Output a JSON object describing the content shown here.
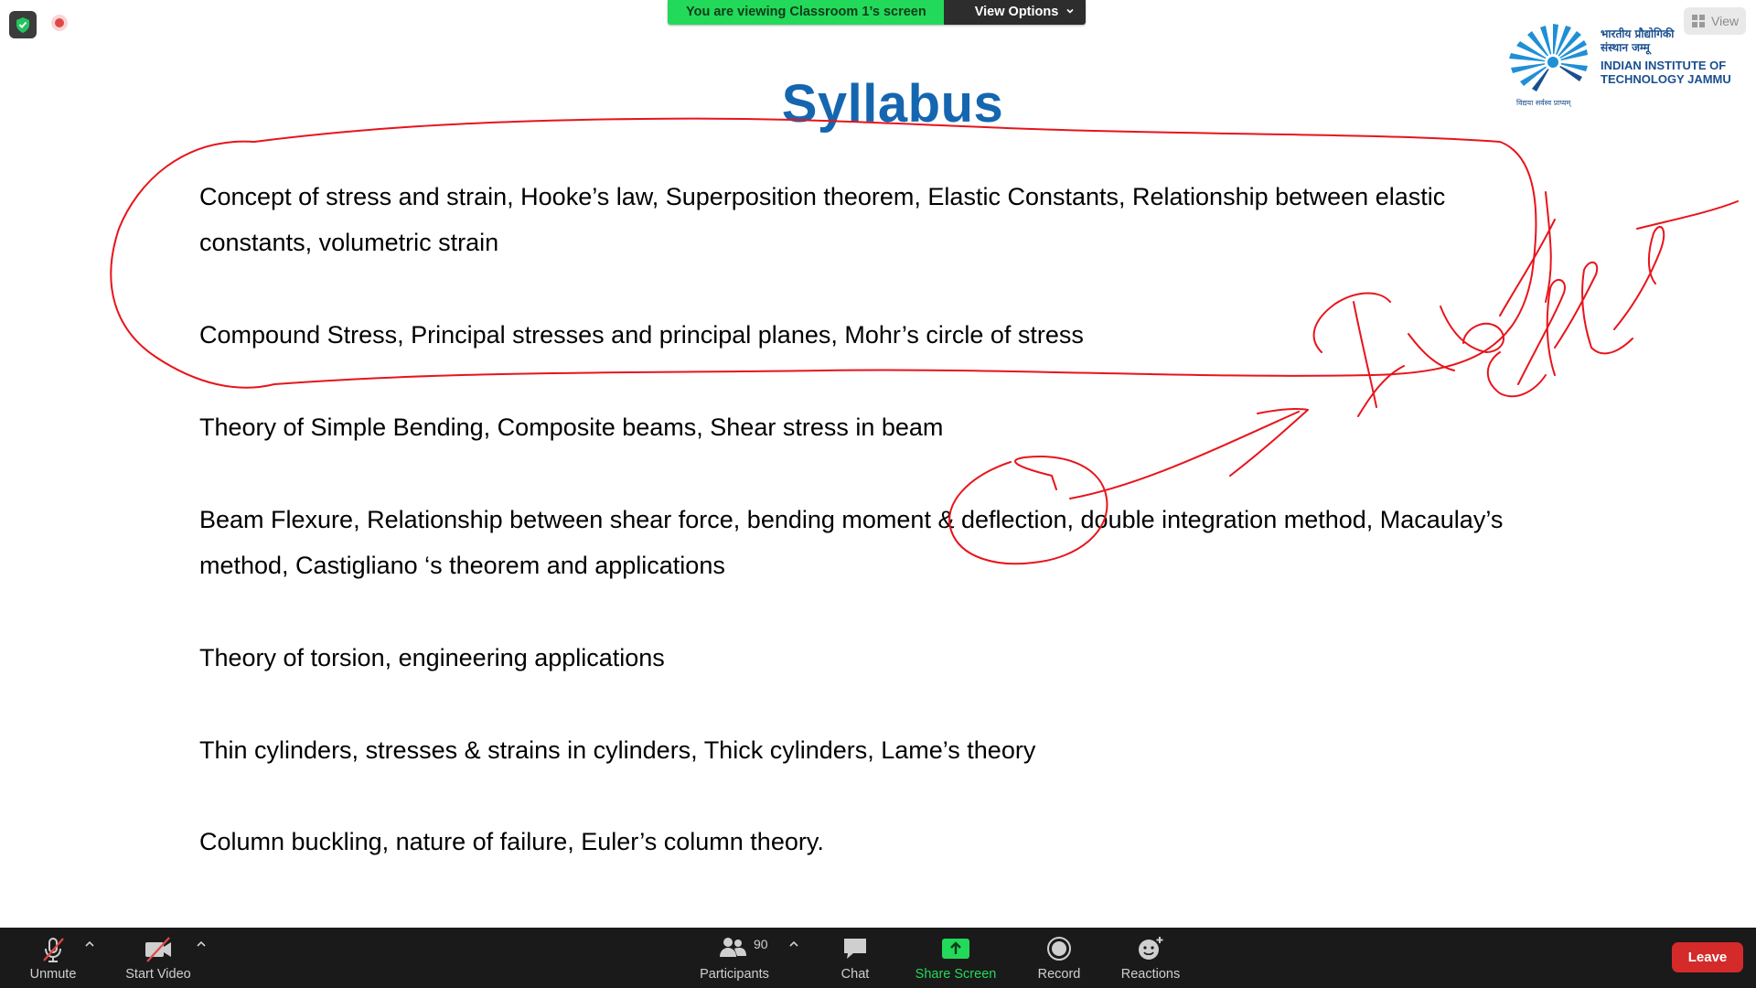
{
  "banner": {
    "viewing_text": "You are viewing Classroom 1’s screen",
    "view_options_label": "View Options"
  },
  "top_right": {
    "view_label": "View"
  },
  "slide": {
    "title": "Syllabus",
    "items": [
      {
        "line1": "Concept of stress and strain, Hooke’s law, Superposition theorem, Elastic Constants, Relationship between elastic",
        "line2": "constants, volumetric strain"
      },
      {
        "line1": "Compound Stress, Principal stresses and principal planes, Mohr’s circle of stress"
      },
      {
        "line1": "Theory of Simple Bending, Composite beams, Shear stress in beam"
      },
      {
        "line1": "Beam Flexure, Relationship between shear force, bending moment & deflection, double integration method, Macaulay’s",
        "line2": "method, Castigliano ‘s theorem and applications"
      },
      {
        "line1": "Theory of torsion, engineering applications"
      },
      {
        "line1": "Thin cylinders, stresses & strains in cylinders, Thick cylinders, Lame’s theory"
      },
      {
        "line1": "Column buckling, nature of failure, Euler’s column theory."
      }
    ],
    "logo": {
      "hindi_line1": "भारतीय प्रौद्योगिकी",
      "hindi_line2": "संस्थान जम्मू",
      "english_line1": "INDIAN INSTITUTE OF",
      "english_line2": "TECHNOLOGY JAMMU",
      "motto": "विद्यया सर्वस्व प्राप्यम्"
    }
  },
  "toolbar": {
    "unmute_label": "Unmute",
    "start_video_label": "Start Video",
    "participants_label": "Participants",
    "participants_count": "90",
    "chat_label": "Chat",
    "share_screen_label": "Share Screen",
    "record_label": "Record",
    "reactions_label": "Reactions",
    "leave_label": "Leave"
  },
  "colors": {
    "title_blue": "#1566b0",
    "annotation_red": "#e8141c",
    "banner_green": "#23d959",
    "toolbar_bg": "#1a1a1a",
    "leave_red": "#d52a2a"
  }
}
